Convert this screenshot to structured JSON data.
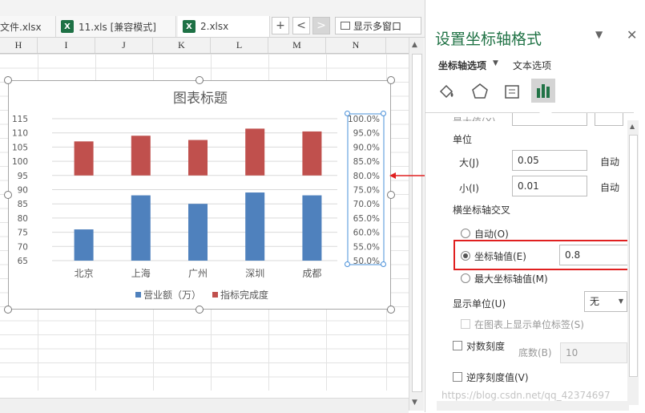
{
  "tabs": [
    {
      "label": "文件.xlsx",
      "icon": ""
    },
    {
      "label": "11.xls  [兼容模式]",
      "icon": "excel-icon"
    },
    {
      "label": "2.xlsx",
      "icon": "excel-icon"
    }
  ],
  "tab_controls": {
    "add": "+",
    "prev": "<",
    "next": ">",
    "show_multi": "显示多窗口"
  },
  "columns": [
    "H",
    "I",
    "J",
    "K",
    "L",
    "M",
    "N"
  ],
  "chart": {
    "title": "图表标题",
    "legend": [
      "营业额（万）",
      "指标完成度"
    ]
  },
  "chart_data": {
    "type": "bar",
    "title": "图表标题",
    "categories": [
      "北京",
      "上海",
      "广州",
      "深圳",
      "成都"
    ],
    "series": [
      {
        "name": "营业额（万）",
        "axis": "primary",
        "values": [
          76,
          88,
          85,
          89,
          88
        ],
        "color": "#4f81bd"
      },
      {
        "name": "指标完成度",
        "axis": "secondary",
        "values": [
          0.92,
          0.94,
          0.925,
          0.965,
          0.955
        ],
        "color": "#c0504d"
      }
    ],
    "primary_axis": {
      "ylim": [
        65,
        115
      ],
      "ticks": [
        "115",
        "110",
        "105",
        "100",
        "95",
        "90",
        "85",
        "80",
        "75",
        "70",
        "65"
      ]
    },
    "secondary_axis": {
      "ylim": [
        0.5,
        1.0
      ],
      "crosses_at": 0.8,
      "ticks": [
        "100.0%",
        "95.0%",
        "90.0%",
        "85.0%",
        "80.0%",
        "75.0%",
        "70.0%",
        "65.0%",
        "60.0%",
        "55.0%",
        "50.0%"
      ]
    },
    "grid": true,
    "legend_position": "bottom"
  },
  "pane": {
    "title": "设置坐标轴格式",
    "tab_axis_options": "坐标轴选项",
    "tab_text_options": "文本选项",
    "cut_label": "最大值(X)",
    "unit_label": "单位",
    "major_label": "大(J)",
    "major_value": "0.05",
    "minor_label": "小(I)",
    "minor_value": "0.01",
    "auto": "自动",
    "h_axis_cross": "横坐标轴交叉",
    "opt_auto": "自动(O)",
    "opt_axis_value": "坐标轴值(E)",
    "axis_value": "0.8",
    "opt_max": "最大坐标轴值(M)",
    "display_units": "显示单位(U)",
    "display_units_value": "无",
    "show_units_label": "在图表上显示单位标签(S)",
    "log_scale": "对数刻度",
    "base_label": "底数(B)",
    "base_value": "10",
    "reverse": "逆序刻度值(V)",
    "watermark": "https://blog.csdn.net/qq_42374697"
  },
  "colors": {
    "accent": "#217346",
    "blue": "#4f81bd",
    "red": "#c0504d",
    "highlight": "#e02020"
  }
}
